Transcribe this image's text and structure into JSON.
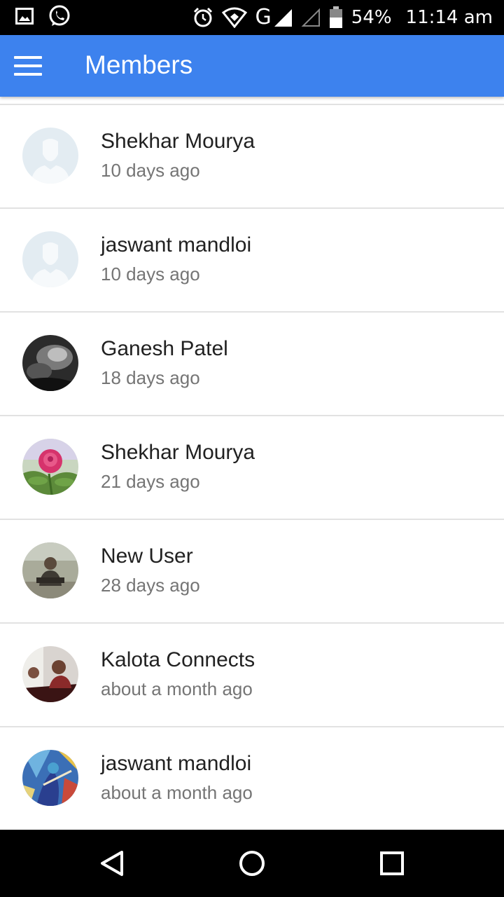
{
  "status_bar": {
    "battery": "54%",
    "time": "11:14 am",
    "network": "G",
    "left_icons": [
      "gallery-icon",
      "whatsapp-icon"
    ],
    "right_icons": [
      "alarm-icon",
      "wifi-icon",
      "signal-icon",
      "signal-empty-icon",
      "battery-icon"
    ]
  },
  "app_bar": {
    "title": "Members",
    "color": "#3d82ee",
    "menu_icon": "hamburger-menu-icon"
  },
  "members": [
    {
      "name": "Shekhar Mourya",
      "time": "10 days ago",
      "avatar": "default-avatar"
    },
    {
      "name": "jaswant mandloi",
      "time": "10 days ago",
      "avatar": "default-avatar"
    },
    {
      "name": "Ganesh Patel",
      "time": "18 days ago",
      "avatar": "grayscale-photo"
    },
    {
      "name": "Shekhar Mourya",
      "time": "21 days ago",
      "avatar": "pink-rose-photo"
    },
    {
      "name": "New User",
      "time": "28 days ago",
      "avatar": "person-photo"
    },
    {
      "name": "Kalota Connects",
      "time": "about a month ago",
      "avatar": "group-photo"
    },
    {
      "name": "jaswant mandloi",
      "time": "about a month ago",
      "avatar": "painting-photo"
    }
  ],
  "nav_bar": {
    "buttons": [
      "back-icon",
      "home-icon",
      "recents-icon"
    ]
  }
}
